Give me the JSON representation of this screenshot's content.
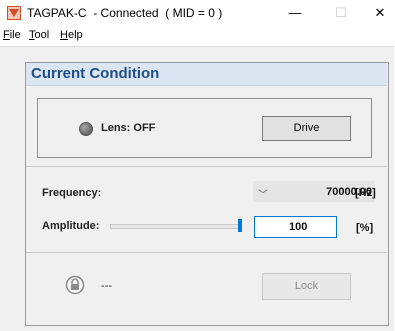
{
  "window": {
    "title": "TAGPAK-C  - Connected  ( MID = 0 )",
    "minimize": "—",
    "maximize": "☐",
    "close": "✕"
  },
  "menu": [
    {
      "key": "F",
      "rest": "ile"
    },
    {
      "key": "T",
      "rest": "ool"
    },
    {
      "key": "H",
      "rest": "elp"
    }
  ],
  "panel": {
    "title": "Current Condition",
    "lens_label": "Lens: OFF",
    "drive_button": "Drive",
    "frequency_label": "Frequency:",
    "frequency_caret": "﹀",
    "frequency_value": "70000.00",
    "frequency_unit": "[Hz]",
    "amplitude_label": "Amplitude:",
    "amplitude_slider_fraction": 1.0,
    "amplitude_value": "100",
    "amplitude_unit": "[%]",
    "lock_status": "---",
    "lock_button": "Lock"
  },
  "colors": {
    "accent": "#0078d7",
    "panel_title": "#1f4f86",
    "panel_header_bg": "#dce6f2"
  }
}
